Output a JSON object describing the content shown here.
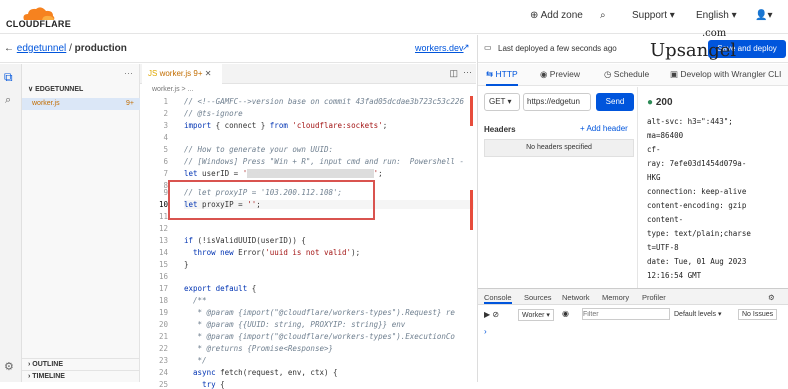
{
  "topbar": {
    "logo": "CLOUDFLARE",
    "add_zone": "Add zone",
    "support": "Support",
    "language": "English"
  },
  "breadcrumb": {
    "project": "edgetunnel",
    "separator": "/",
    "env": "production"
  },
  "workers_link": "workers.dev",
  "deploy": {
    "status": "Last deployed a few seconds ago",
    "button": "Save and deploy"
  },
  "watermark": {
    "line1": ".com",
    "line2": "Upsangel"
  },
  "explorer": {
    "section": "EDGETUNNEL",
    "file": "worker.js",
    "badge": "9+",
    "outline": "OUTLINE",
    "timeline": "TIMELINE"
  },
  "editor": {
    "tab": "worker.js 9+",
    "path": "worker.js > ...",
    "line_numbers": [
      "1",
      "2",
      "3",
      "4",
      "5",
      "6",
      "7",
      "8",
      "9",
      "10",
      "11",
      "12",
      "13",
      "14",
      "15",
      "16",
      "17",
      "18",
      "19",
      "20",
      "21",
      "22",
      "23",
      "24",
      "25"
    ]
  },
  "right_tabs": [
    "HTTP",
    "Preview",
    "Schedule",
    "Develop with Wrangler CLI"
  ],
  "request": {
    "method": "GET",
    "url": "https://edgetun",
    "send": "Send",
    "headers_title": "Headers",
    "add_header": "+ Add header",
    "no_headers": "No headers specified"
  },
  "response": {
    "status": "200",
    "headers": [
      "alt-svc: h3=\":443\";",
      "ma=86400",
      "cf-",
      "ray: 7efe03d1454d079a-",
      "HKG",
      "connection: keep-alive",
      "content-encoding: gzip",
      "content-",
      "type: text/plain;charse",
      "t=UTF-8",
      "date: Tue, 01 Aug 2023",
      "12:16:54 GMT"
    ]
  },
  "console": {
    "tabs": [
      "Console",
      "Sources",
      "Network",
      "Memory",
      "Profiler"
    ],
    "context": "Worker",
    "filter_placeholder": "Filter",
    "levels": "Default levels",
    "issues": "No Issues"
  },
  "colors": {
    "accent": "#0055dc",
    "orange": "#f6821f",
    "highlight": "#d9534f"
  }
}
